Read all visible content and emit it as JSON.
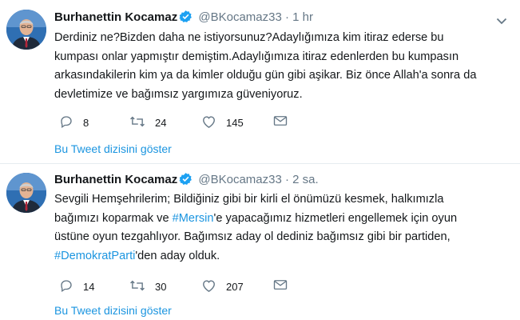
{
  "tweets": [
    {
      "fullname": "Burhanettin Kocamaz",
      "handle": "@BKocamaz33",
      "separator": "·",
      "time": "1 hr",
      "text_lines": [
        "Derdiniz ne?Bizden daha ne istiyorsunuz?Adaylığımıza kim itiraz ederse bu",
        "kumpası onlar yapmıştır demiştim.Adaylığımıza itiraz edenlerden bu kumpasın",
        "arkasındakilerin kim ya da kimler olduğu gün gibi aşikar. Biz önce Allah'a sonra da",
        "devletimize ve bağımsız yargımıza güveniyoruz."
      ],
      "replies": "8",
      "retweets": "24",
      "likes": "145",
      "thread_link": "Bu Tweet dizisini göster"
    },
    {
      "fullname": "Burhanettin Kocamaz",
      "handle": "@BKocamaz33",
      "separator": "·",
      "time": "2 sa.",
      "text": {
        "line1": "Sevgili Hemşehrilerim; Bildiğiniz gibi bir kirli el önümüzü kesmek, halkımızla",
        "line2_before": "bağımızı koparmak ve ",
        "hashtag1": "#Mersin",
        "line2_after": "'e yapacağımız hizmetleri engellemek için oyun",
        "line3": "üstüne oyun tezgahlıyor. Bağımsız aday ol dediniz bağımsız gibi bir partiden,",
        "hashtag2": "#DemokratParti",
        "line4_after": "'den aday olduk."
      },
      "replies": "14",
      "retweets": "30",
      "likes": "207",
      "thread_link": "Bu Tweet dizisini göster"
    }
  ],
  "icons": {
    "avatar": "avatar-portrait",
    "verified": "verified-badge-icon",
    "caret": "chevron-down-icon",
    "reply": "reply-icon",
    "retweet": "retweet-icon",
    "like": "heart-icon",
    "dm": "envelope-icon"
  },
  "colors": {
    "link": "#1b95e0",
    "verified": "#1da1f2",
    "muted": "#657786",
    "text": "#14171a",
    "divider": "#e6ecf0"
  }
}
